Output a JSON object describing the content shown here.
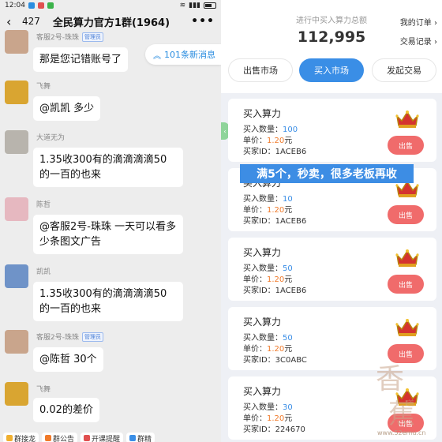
{
  "status_bar": {
    "time": "12:04"
  },
  "chat": {
    "back_icon": "chevron-left-icon",
    "unread_count": "427",
    "title": "全民算力官方1群(1964)",
    "more_icon": "more-dots-icon",
    "new_messages_pill": "101条新消息",
    "messages": [
      {
        "sender": "客服2号-珠珠",
        "tag": "管理员",
        "text": "那是您记错账号了",
        "avatar_color": "#c9a58c"
      },
      {
        "sender": "飞舞",
        "tag": "",
        "text": "@凯凯 多少",
        "avatar_color": "#d9a531"
      },
      {
        "sender": "大道无为",
        "tag": "",
        "text": "1.35收300有的滴滴滴滴50的一百的也来",
        "avatar_color": "#b8b4ad"
      },
      {
        "sender": "陈哲",
        "tag": "",
        "text": "@客服2号-珠珠 一天可以看多少条图文广告",
        "avatar_color": "#e6b8c0"
      },
      {
        "sender": "凯凯",
        "tag": "",
        "text": "1.35收300有的滴滴滴滴50的一百的也来",
        "avatar_color": "#6f93c8"
      },
      {
        "sender": "客服2号-珠珠",
        "tag": "管理员",
        "text": "@陈哲 30个",
        "avatar_color": "#c9a58c"
      },
      {
        "sender": "飞舞",
        "tag": "",
        "text": "0.02的差价",
        "avatar_color": "#d9a531"
      }
    ],
    "bottom_chips": [
      "群接龙",
      "群公告",
      "开课提醒",
      "群精"
    ]
  },
  "market": {
    "total_label": "进行中买入算力总额",
    "total_value": "112,995",
    "my_orders": "我的订单 ›",
    "trade_records": "交易记录 ›",
    "tabs": [
      {
        "label": "出售市场",
        "active": false
      },
      {
        "label": "买入市场",
        "active": true
      },
      {
        "label": "发起交易",
        "active": false
      }
    ],
    "side_handle": "‹",
    "labels": {
      "card_title": "买入算力",
      "qty": "买入数量：",
      "price": "单价：",
      "buyer": "买家ID：",
      "unit": "元",
      "sell": "出售"
    },
    "orders": [
      {
        "qty": "100",
        "price": "1.20",
        "buyer_id": "1ACEB6"
      },
      {
        "qty": "10",
        "price": "1.20",
        "buyer_id": "1ACEB6"
      },
      {
        "qty": "50",
        "price": "1.20",
        "buyer_id": "1ACEB6"
      },
      {
        "qty": "50",
        "price": "1.20",
        "buyer_id": "3C0ABC"
      },
      {
        "qty": "30",
        "price": "1.20",
        "buyer_id": "224670"
      }
    ],
    "overlay_caption": "满5个，秒卖，很多老板再收",
    "watermark_url": "www.52emu.cn",
    "colors": {
      "accent": "#3a8ee6",
      "sell": "#f06b6b",
      "price": "#f07a2a"
    }
  }
}
